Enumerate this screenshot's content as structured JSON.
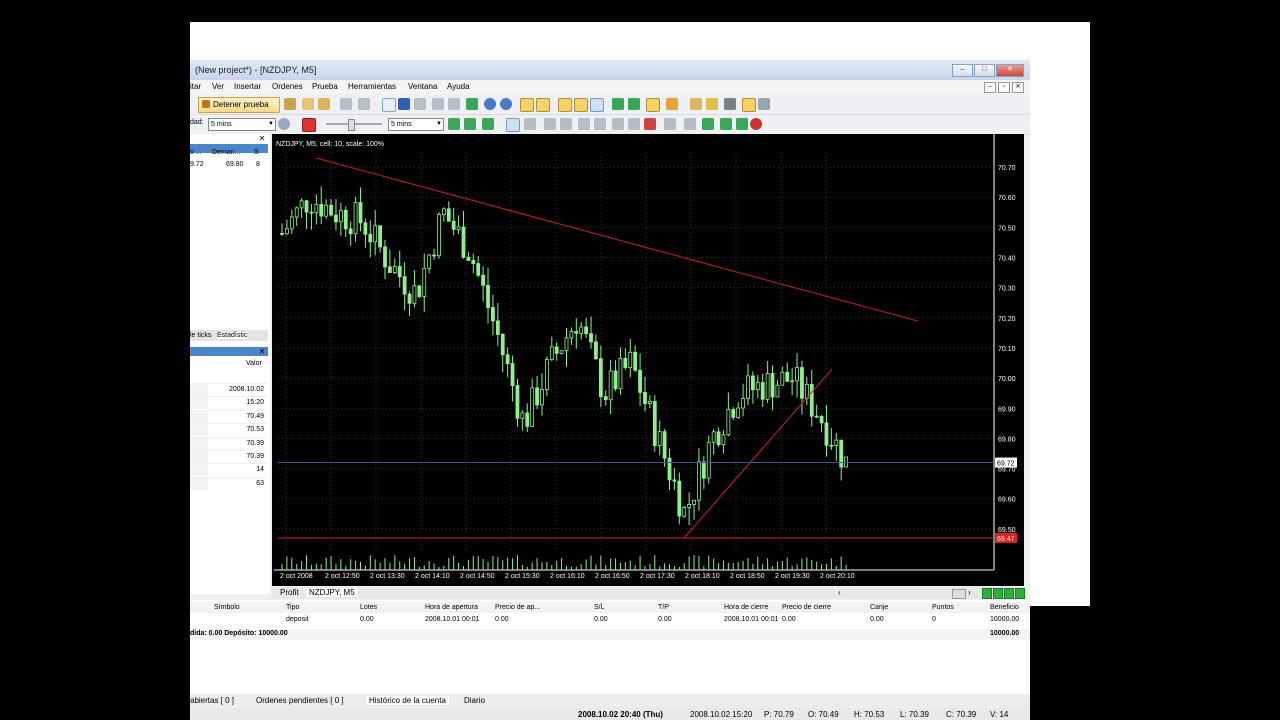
{
  "window": {
    "title": "(New project*) - [NZDJPY, M5]"
  },
  "menu": [
    "itar",
    "Ver",
    "Insertar",
    "Ordenes",
    "Prueba",
    "Herramientas",
    "Ventana",
    "Ayuda"
  ],
  "toolbar": {
    "stop_label": "Detener prueba",
    "speed_label": "dad:",
    "speed_value": "5 mins",
    "timeframe_value": "5 mins"
  },
  "market": {
    "col_bid": "o ...",
    "col_ask": "Deman...",
    "col_s": "S",
    "bid": "9.72",
    "ask": "69.80",
    "s": "8"
  },
  "stats": {
    "tab1": "le ticks",
    "tab2": "Estadístic",
    "value_header": "Valor",
    "values": [
      "2008.10.02",
      "15:20",
      "70.49",
      "70.53",
      "70.39",
      "70.39",
      "14",
      "63"
    ]
  },
  "chart": {
    "info": "NZDJPY, M5, cell: 10, scale: 100%",
    "price_ticks": [
      "70.70",
      "70.60",
      "70.50",
      "70.40",
      "70.30",
      "70.20",
      "70.10",
      "70.00",
      "69.90",
      "69.80",
      "69.70",
      "69.60",
      "69.50"
    ],
    "time_ticks": [
      "2 oct 2008",
      "2 oct 12:50",
      "2 oct 13:30",
      "2 oct 14:10",
      "2 oct 14:50",
      "2 oct 15:30",
      "2 oct 16:10",
      "2 oct 16:50",
      "2 oct 17:30",
      "2 oct 18:10",
      "2 oct 18:50",
      "2 oct 19:30",
      "2 oct 20:10"
    ],
    "bid_label": "69.72",
    "red_label": "69.47",
    "candle_color": "#90ee90",
    "trendline_color": "#cc2222"
  },
  "chart_data": {
    "type": "candlestick",
    "title": "NZDJPY, M5",
    "ylim": [
      69.43,
      70.75
    ],
    "x": [
      "2 oct 2008",
      "2 oct 12:50",
      "2 oct 13:30",
      "2 oct 14:10",
      "2 oct 14:50",
      "2 oct 15:30",
      "2 oct 16:10",
      "2 oct 16:50",
      "2 oct 17:30",
      "2 oct 18:10",
      "2 oct 18:50",
      "2 oct 19:30",
      "2 oct 20:10"
    ],
    "close_path": [
      70.48,
      70.6,
      70.55,
      70.52,
      70.38,
      70.28,
      70.55,
      70.42,
      70.15,
      69.85,
      70.05,
      70.2,
      69.95,
      70.05,
      69.8,
      69.55,
      69.8,
      69.95,
      69.98,
      70.0,
      69.88,
      69.72
    ],
    "horizontal_lines": [
      69.72,
      69.47
    ]
  },
  "subtabs": {
    "profit": "Profit",
    "chart_tab": "NZDJPY, M5"
  },
  "terminal": {
    "headers": [
      "Símbolo",
      "Tipo",
      "Lotes",
      "Hora de apertura",
      "Precio de ap...",
      "S/L",
      "T/P",
      "Hora de cierre",
      "Precio de cierre",
      "Canje",
      "Puntos",
      "Beneficio"
    ],
    "row": [
      "",
      "deposit",
      "0.00",
      "2008.10.01 00:01",
      "0.00",
      "0.00",
      "0.00",
      "2008.10.01 00:01",
      "0.00",
      "0.00",
      "0",
      "10000.00"
    ],
    "summary_left": "dida: 0.00 Depósito: 10000.00",
    "summary_right": "10000.00"
  },
  "bottom_tabs": [
    "abiertas  [ 0 ]",
    "Ordenes pendientes  [ 0 ]",
    "Histórico de la cuenta",
    "Diario"
  ],
  "statusbar": [
    "2008.10.02 20:40 (Thu)",
    "2008.10.02 15:20",
    "P: 70.79",
    "O: 70.49",
    "H: 70.53",
    "L: 70.39",
    "C: 70.39",
    "V: 14"
  ]
}
